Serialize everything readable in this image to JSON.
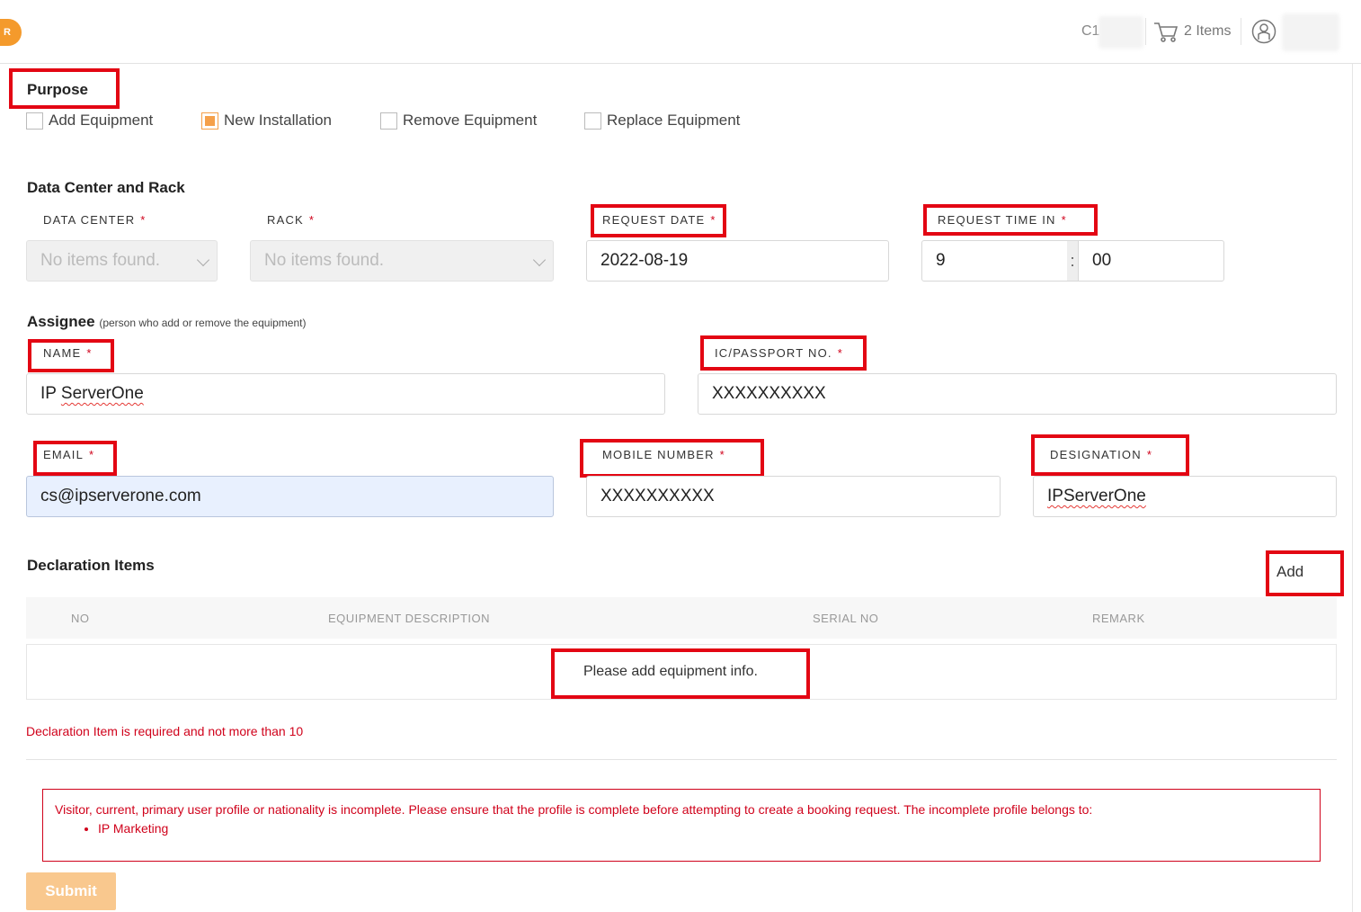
{
  "header": {
    "logo_letter": "R",
    "account_prefix": "C1",
    "cart_label": "2 Items"
  },
  "purpose": {
    "title": "Purpose",
    "options": [
      {
        "label": "Add Equipment",
        "checked": false
      },
      {
        "label": "New Installation",
        "checked": true
      },
      {
        "label": "Remove Equipment",
        "checked": false
      },
      {
        "label": "Replace Equipment",
        "checked": false
      }
    ]
  },
  "dc_rack": {
    "title": "Data Center and Rack",
    "data_center_label": "DATA CENTER",
    "data_center_value": "No items found.",
    "rack_label": "RACK",
    "rack_value": "No items found.",
    "request_date_label": "REQUEST DATE",
    "request_date_value": "2022-08-19",
    "request_time_label": "REQUEST TIME IN",
    "time_hour": "9",
    "time_sep": ":",
    "time_minute": "00"
  },
  "assignee": {
    "title": "Assignee",
    "note": "(person who add or remove the equipment)",
    "name_label": "NAME",
    "name_value": "IP ServerOne",
    "ic_label": "IC/PASSPORT NO.",
    "ic_value": "XXXXXXXXXX",
    "email_label": "EMAIL",
    "email_value": "cs@ipserverone.com",
    "mobile_label": "MOBILE NUMBER",
    "mobile_value": "XXXXXXXXXX",
    "designation_label": "DESIGNATION",
    "designation_value": "IPServerOne"
  },
  "required_marker": "*",
  "declaration": {
    "title": "Declaration Items",
    "add_label": "Add",
    "columns": [
      "NO",
      "EQUIPMENT DESCRIPTION",
      "SERIAL NO",
      "REMARK"
    ],
    "empty_text": "Please add equipment info.",
    "error_text": "Declaration Item is required and not more than 10"
  },
  "alert": {
    "message": "Visitor, current, primary user profile or nationality is incomplete. Please ensure that the profile is complete before attempting to create a booking request. The incomplete profile belongs to:",
    "items": [
      "IP Marketing"
    ]
  },
  "submit_label": "Submit",
  "colors": {
    "accent": "#f49a2c",
    "highlight": "#e30613",
    "error": "#d0021b"
  }
}
